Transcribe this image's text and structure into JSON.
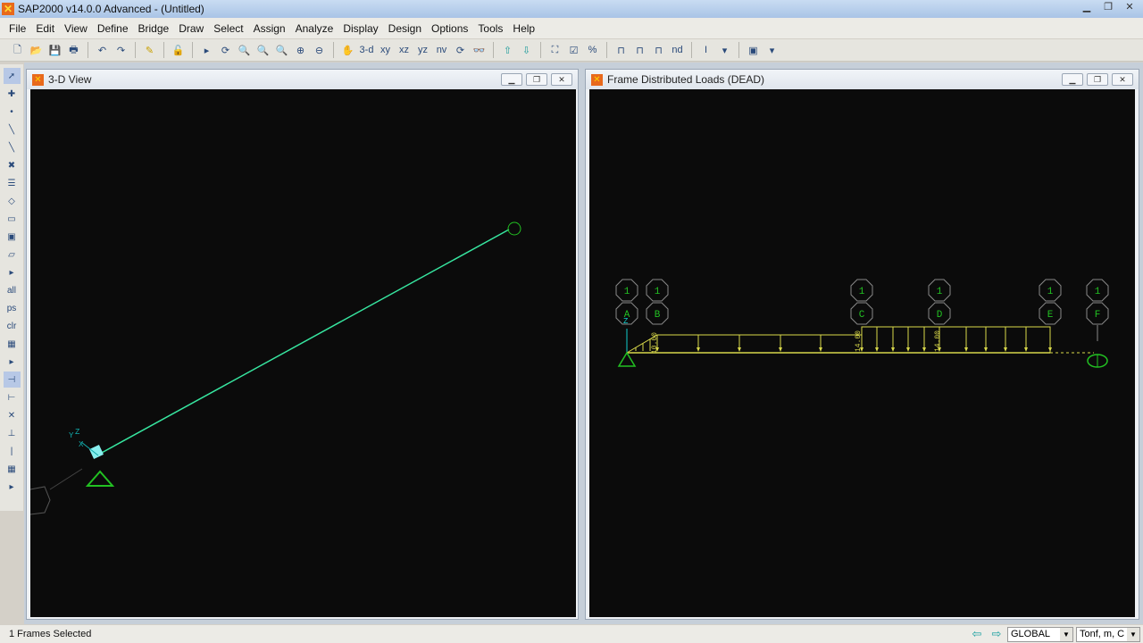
{
  "title": "SAP2000 v14.0.0 Advanced  - (Untitled)",
  "menu": [
    "File",
    "Edit",
    "View",
    "Define",
    "Bridge",
    "Draw",
    "Select",
    "Assign",
    "Analyze",
    "Display",
    "Design",
    "Options",
    "Tools",
    "Help"
  ],
  "toolbar": {
    "view_3d": "3-d",
    "view_xy": "xy",
    "view_xz": "xz",
    "view_yz": "yz",
    "view_nv": "nv",
    "nd": "nd"
  },
  "left_toolbar": {
    "all": "all",
    "ps": "ps",
    "clr": "clr"
  },
  "windows": {
    "left": {
      "title": "3-D View",
      "axis_labels": {
        "z": "Z",
        "y": "Y",
        "x": "X"
      }
    },
    "right": {
      "title": "Frame Distributed Loads (DEAD)",
      "grid_lines": [
        {
          "top": "1",
          "bottom": "A"
        },
        {
          "top": "1",
          "bottom": "B"
        },
        {
          "top": "1",
          "bottom": "C"
        },
        {
          "top": "1",
          "bottom": "D"
        },
        {
          "top": "1",
          "bottom": "E"
        },
        {
          "top": "1",
          "bottom": "F"
        }
      ],
      "load_labels": [
        "10.00",
        "14.00",
        "14.00"
      ],
      "axis_label": "Z"
    }
  },
  "status": {
    "text": "1 Frames Selected",
    "coord_system": "GLOBAL",
    "units": "Tonf, m, C"
  },
  "colors": {
    "load": "#d8d84a",
    "grid_bubble": "#22c022",
    "frame": "#37e6a0",
    "background": "#0b0b0b"
  }
}
